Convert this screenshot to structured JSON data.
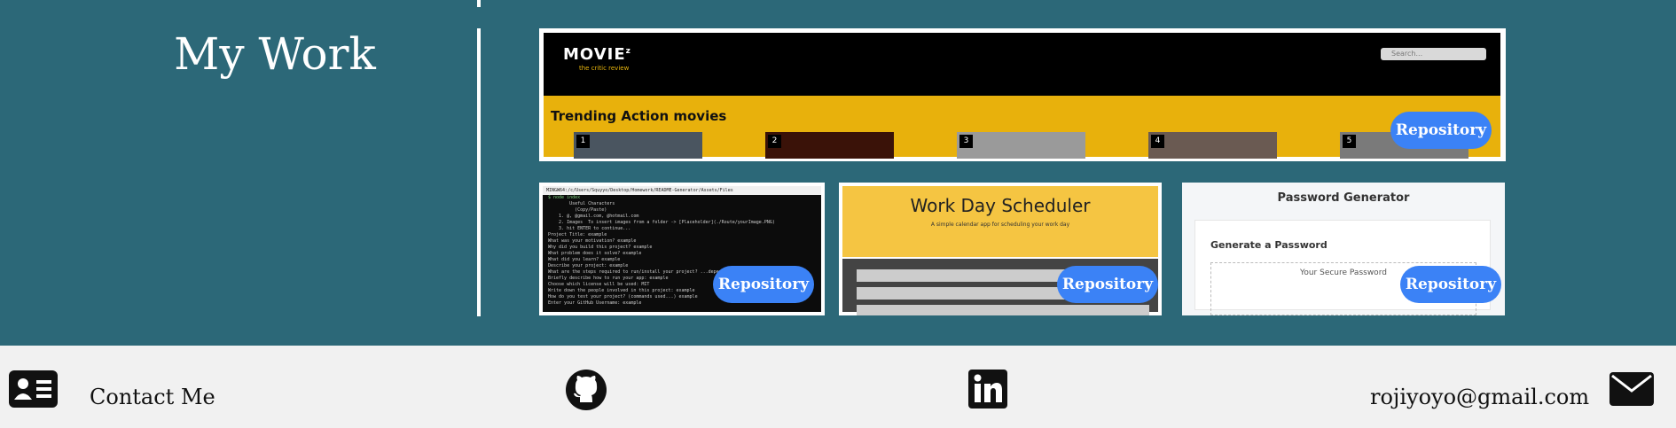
{
  "section": {
    "title": "My Work"
  },
  "projects": {
    "repo_label": "Repository",
    "movie": {
      "logo": "MOVIE",
      "logo_sup": "z",
      "tagline": "the critic review",
      "search_placeholder": "Search...",
      "heading": "Trending Action movies",
      "posters": [
        "1",
        "2",
        "3",
        "4",
        "5"
      ]
    },
    "readme": {
      "window_title": "MINGW64:/c/Users/Squyyo/Desktop/Homework/README-Generator/Assets/Files",
      "lines": [
        "$ node index",
        "",
        "        Useful Characters",
        "          (Copy/Paste)",
        "",
        "    1. @, @gmail.com, @hotmail.com",
        "    2. Images  To insert images from a folder -> [Placeholder](./Route/yourImage.PNG)",
        "    3. hit ENTER to continue...",
        "",
        "Project Title: example",
        "What was your motivation? example",
        "Why did you build this project? example",
        "What problem does it solve? example",
        "What did you learn? example",
        "Describe your project: example",
        "What are the steps required to run/install your project? ...dependencies",
        "Briefly describe how to run your app: example",
        "Choose which license will be used: MIT",
        "Write down the people involved in this project: example",
        "How do you test your project? (commands used...) example",
        "Enter your GitHub Username: example"
      ]
    },
    "scheduler": {
      "title": "Work Day Scheduler",
      "subtitle": "A simple calendar app for scheduling your work day"
    },
    "password": {
      "title": "Password Generator",
      "heading": "Generate a Password",
      "placeholder": "Your Secure Password"
    }
  },
  "footer": {
    "contact": "Contact Me",
    "email": "rojiyoyo@gmail.com",
    "icons": [
      "contact-card-icon",
      "github-icon",
      "linkedin-icon",
      "envelope-icon"
    ]
  },
  "colors": {
    "background": "#2c6878",
    "footer": "#f1f1f1",
    "button": "#3b82f6",
    "movie_accent": "#e8b10c",
    "scheduler_accent": "#f5c542"
  }
}
